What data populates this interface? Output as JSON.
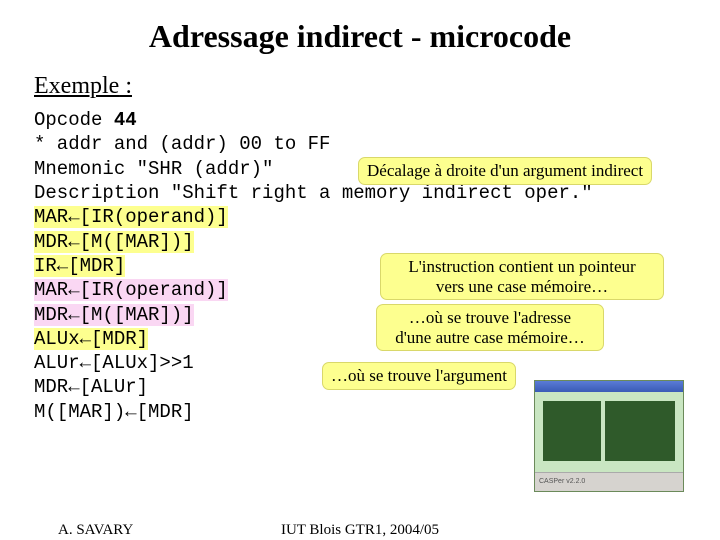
{
  "title": "Adressage indirect - microcode",
  "subtitle_prefix": "Exemple",
  "subtitle_suffix": " :",
  "code": {
    "l1a": "Opcode ",
    "l1b": "44",
    "l2": "* addr and (addr) 00 to FF",
    "l3": "Mnemonic \"SHR (addr)\"",
    "l4": "Description \"Shift right a memory indirect oper.\"",
    "l5": "MAR←[IR(operand)]",
    "l6": "MDR←[M([MAR])]",
    "l7": "IR←[MDR]",
    "l8": "MAR←[IR(operand)]",
    "l9": "MDR←[M([MAR])]",
    "l10": "ALUx←[MDR]",
    "l11": "ALUr←[ALUx]>>1",
    "l12": "MDR←[ALUr]",
    "l13": "M([MAR])←[MDR]"
  },
  "callouts": {
    "c1": "Décalage à droite d'un argument indirect",
    "c2a": "L'instruction contient un pointeur",
    "c2b": "vers une case mémoire…",
    "c3a": "…où se trouve l'adresse",
    "c3b": "d'une autre case mémoire…",
    "c4": "…où se trouve l'argument"
  },
  "bgimg_caption": "CASPer v2.2.0",
  "footer": {
    "author": "A. SAVARY",
    "course": "IUT Blois GTR1, 2004/05"
  }
}
